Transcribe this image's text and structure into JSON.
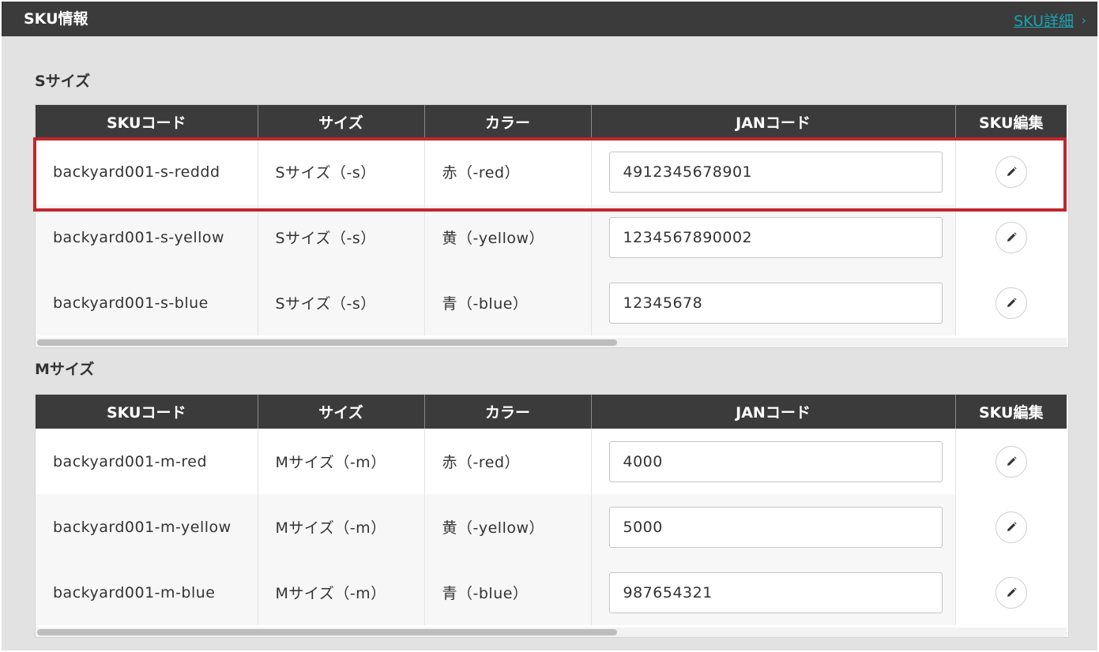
{
  "header": {
    "title": "SKU情報",
    "detail_link": "SKU詳細",
    "chevron": "›"
  },
  "columns": [
    "SKUコード",
    "サイズ",
    "カラー",
    "JANコード",
    "SKU編集"
  ],
  "sections": [
    {
      "title": "Sサイズ",
      "rows": [
        {
          "sku": "backyard001-s-reddd",
          "size": "Sサイズ（-s）",
          "color": "赤（-red）",
          "jan": "4912345678901"
        },
        {
          "sku": "backyard001-s-yellow",
          "size": "Sサイズ（-s）",
          "color": "黄（-yellow）",
          "jan": "1234567890002"
        },
        {
          "sku": "backyard001-s-blue",
          "size": "Sサイズ（-s）",
          "color": "青（-blue）",
          "jan": "12345678"
        }
      ]
    },
    {
      "title": "Mサイズ",
      "rows": [
        {
          "sku": "backyard001-m-red",
          "size": "Mサイズ（-m）",
          "color": "赤（-red）",
          "jan": "4000"
        },
        {
          "sku": "backyard001-m-yellow",
          "size": "Mサイズ（-m）",
          "color": "黄（-yellow）",
          "jan": "5000"
        },
        {
          "sku": "backyard001-m-blue",
          "size": "Mサイズ（-m）",
          "color": "青（-blue）",
          "jan": "987654321"
        }
      ]
    }
  ],
  "highlight_color": "#c0262d",
  "accent_color": "#1aa3b0",
  "edit_icon": "pencil-icon"
}
